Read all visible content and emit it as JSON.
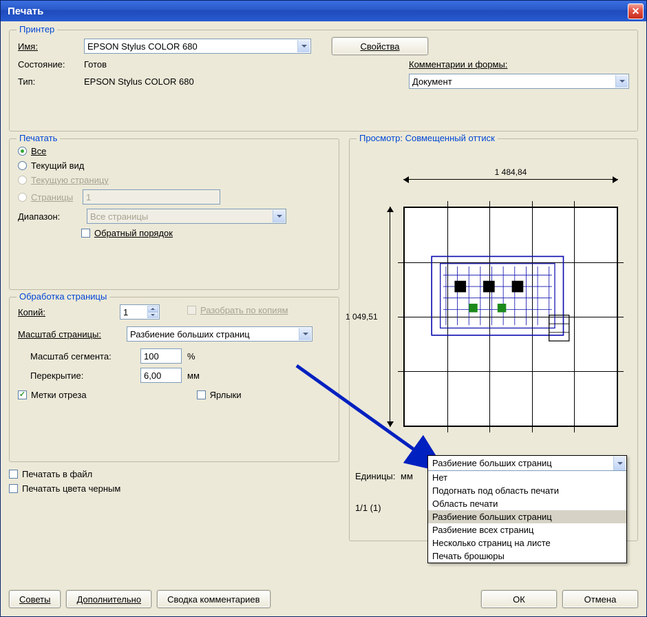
{
  "title": "Печать",
  "printer": {
    "legend": "Принтер",
    "name_label": "Имя:",
    "name_value": "EPSON Stylus COLOR 680",
    "properties_btn": "Свойства",
    "status_label": "Состояние:",
    "status_value": "Готов",
    "type_label": "Тип:",
    "type_value": "EPSON Stylus COLOR 680",
    "comments_label": "Комментарии и формы:",
    "comments_value": "Документ"
  },
  "range": {
    "legend": "Печатать",
    "all": "Все",
    "current_view": "Текущий вид",
    "current_page": "Текущую страницу",
    "pages": "Страницы",
    "pages_value": "1",
    "subrange_label": "Диапазон:",
    "subrange_value": "Все страницы",
    "reverse": "Обратный порядок"
  },
  "handling": {
    "legend": "Обработка страницы",
    "copies_label": "Копий:",
    "copies_value": "1",
    "collate": "Разобрать по копиям",
    "scale_label": "Масштаб страницы:",
    "scale_value": "Разбиение больших страниц",
    "tile_scale_label": "Масштаб сегмента:",
    "tile_scale_value": "100",
    "tile_scale_unit": "%",
    "overlap_label": "Перекрытие:",
    "overlap_value": "6,00",
    "overlap_unit": "мм",
    "cut_marks": "Метки отреза",
    "labels": "Ярлыки"
  },
  "opts": {
    "print_to_file": "Печатать в файл",
    "print_black": "Печатать цвета черным"
  },
  "preview": {
    "legend": "Просмотр: Совмещенный оттиск",
    "width": "1 484,84",
    "height": "1 049,51",
    "units_label": "Единицы:",
    "units_value": "мм",
    "page_counter": "1/1 (1)"
  },
  "popup": {
    "selected": "Разбиение больших страниц",
    "items": [
      "Нет",
      "Подогнать под область печати",
      "Область печати",
      "Разбиение больших страниц",
      "Разбиение всех страниц",
      "Несколько страниц на листе",
      "Печать брошюры"
    ]
  },
  "buttons": {
    "tips": "Советы",
    "advanced": "Дополнительно",
    "comments_summary": "Сводка комментариев",
    "ok": "ОК",
    "cancel": "Отмена"
  }
}
